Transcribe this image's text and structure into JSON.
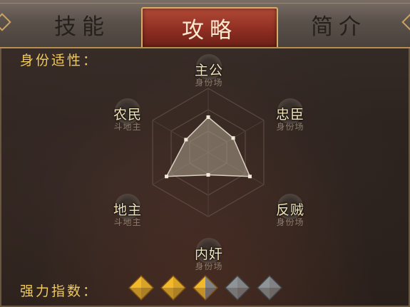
{
  "tabs": {
    "skill": "技能",
    "guide": "攻略",
    "intro": "简介"
  },
  "section": {
    "identity_label": "身份适性：",
    "power_label": "强力指数："
  },
  "roles": {
    "top": {
      "name": "主公",
      "sub": "身份场"
    },
    "upper_right": {
      "name": "忠臣",
      "sub": "身份场"
    },
    "lower_right": {
      "name": "反贼",
      "sub": "身份场"
    },
    "bottom": {
      "name": "内奸",
      "sub": "身份场"
    },
    "lower_left": {
      "name": "地主",
      "sub": "斗地主"
    },
    "upper_left": {
      "name": "农民",
      "sub": "斗地主"
    }
  },
  "radar_values": {
    "order": [
      "主公",
      "忠臣",
      "反贼",
      "内奸",
      "地主",
      "农民"
    ],
    "values": [
      0.55,
      0.45,
      0.75,
      0.35,
      0.75,
      0.4
    ],
    "levels": 3
  },
  "power_index": {
    "max": 5,
    "value": 2.5,
    "colors": {
      "on": "#f2b92a",
      "off": "#8d9396"
    }
  }
}
